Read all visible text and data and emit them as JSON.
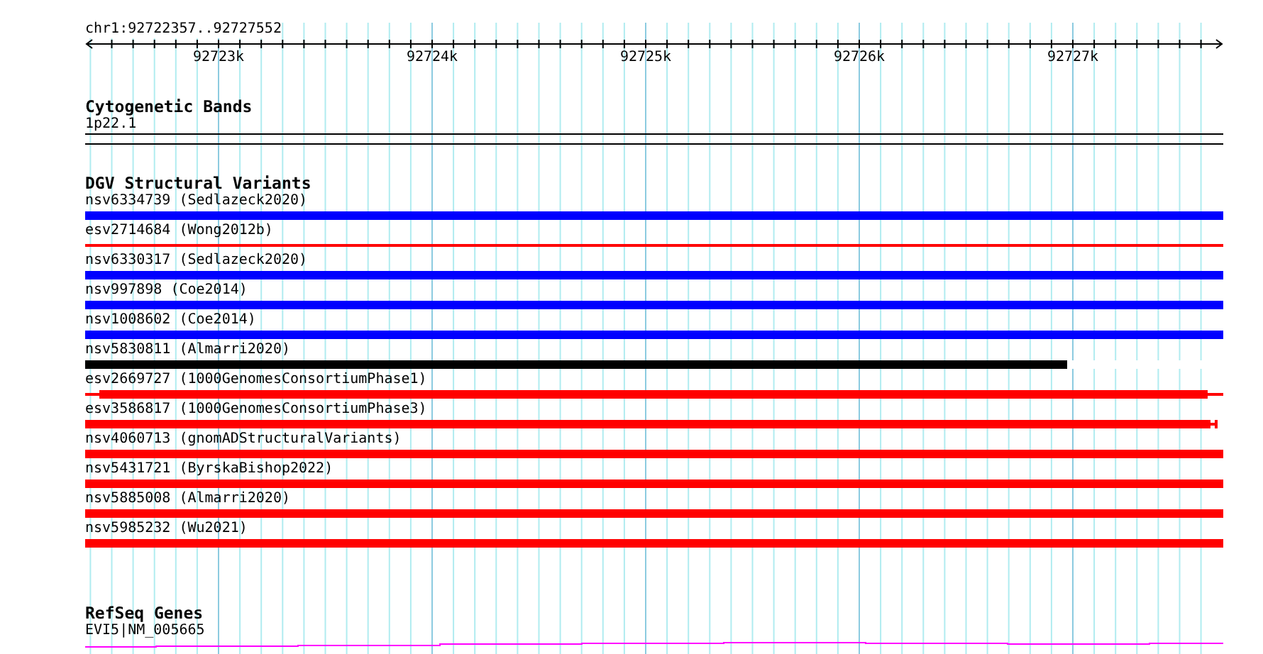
{
  "location": "chr1:92722357..92727552",
  "ruler": {
    "ticks": [
      "92723k",
      "92724k",
      "92725k",
      "92726k",
      "92727k"
    ]
  },
  "tracks": [
    {
      "kind": "bands",
      "title": "Cytogenetic Bands",
      "features": [
        {
          "label": "1p22.1"
        }
      ]
    },
    {
      "kind": "variants",
      "title": "DGV Structural Variants",
      "features": [
        {
          "label": "nsv6334739 (Sedlazeck2020)",
          "color": "#0000ff",
          "kind": "full"
        },
        {
          "label": "esv2714684 (Wong2012b)",
          "color": "#ff0000",
          "kind": "thin"
        },
        {
          "label": "nsv6330317 (Sedlazeck2020)",
          "color": "#0000ff",
          "kind": "full"
        },
        {
          "label": "nsv997898 (Coe2014)",
          "color": "#0000ff",
          "kind": "full"
        },
        {
          "label": "nsv1008602 (Coe2014)",
          "color": "#0000ff",
          "kind": "full"
        },
        {
          "label": "nsv5830811 (Almarri2020)",
          "color": "#000000",
          "kind": "partial",
          "level": 0.863
        },
        {
          "label": "esv2669727 (1000GenomesConsortiumPhase1)",
          "color": "#ff0000",
          "kind": "inset"
        },
        {
          "label": "esv3586817 (1000GenomesConsortiumPhase3)",
          "color": "#ff0000",
          "kind": "capped"
        },
        {
          "label": "nsv4060713 (gnomADStructuralVariants)",
          "color": "#ff0000",
          "kind": "full"
        },
        {
          "label": "nsv5431721 (ByrskaBishop2022)",
          "color": "#ff0000",
          "kind": "full"
        },
        {
          "label": "nsv5885008 (Almarri2020)",
          "color": "#ff0000",
          "kind": "full"
        },
        {
          "label": "nsv5985232 (Wu2021)",
          "color": "#ff0000",
          "kind": "full"
        }
      ]
    },
    {
      "kind": "genes",
      "title": "RefSeq Genes",
      "features": [
        {
          "label": "EVI5|NM_005665"
        }
      ]
    }
  ]
}
